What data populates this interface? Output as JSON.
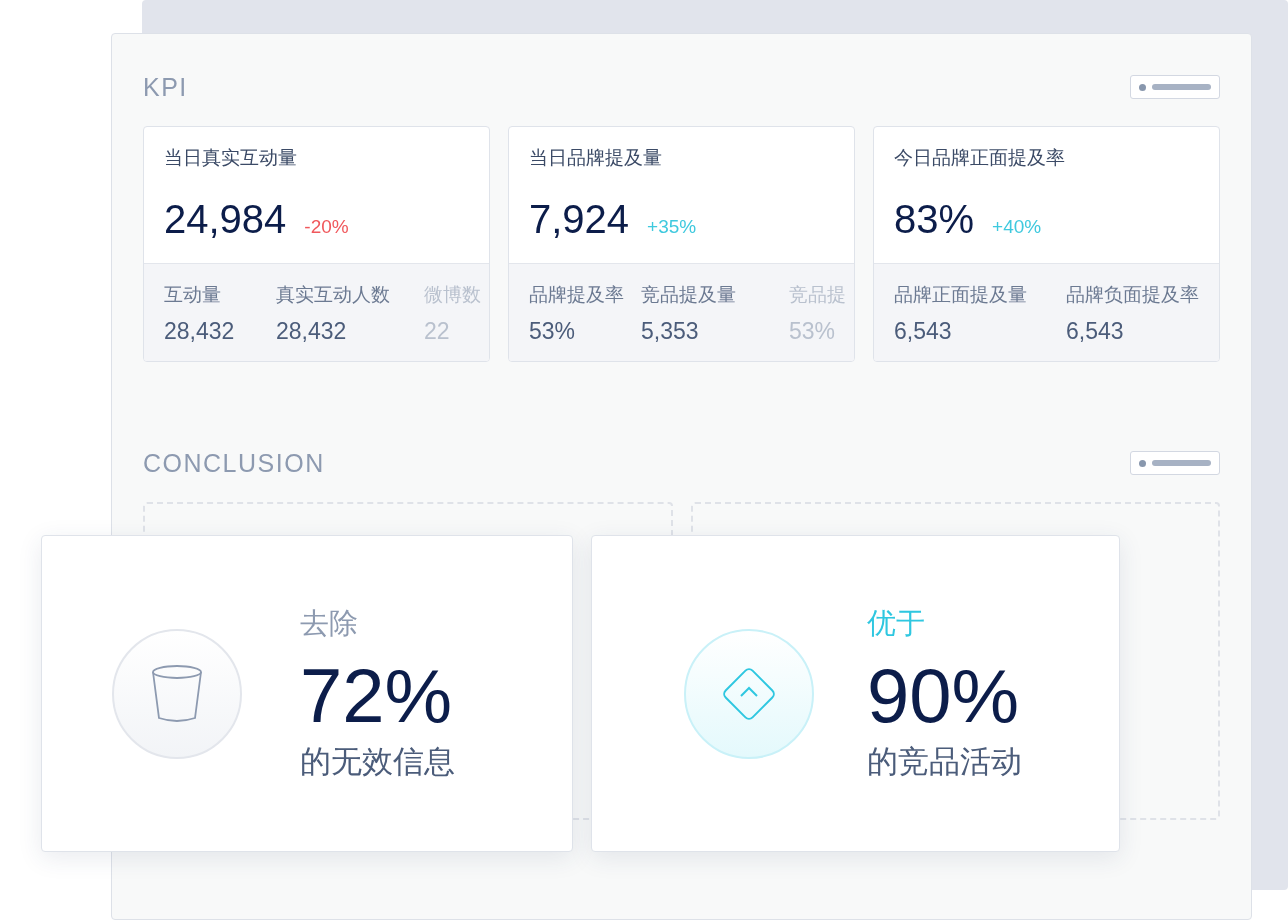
{
  "kpi": {
    "title": "KPI",
    "cards": [
      {
        "title": "当日真实互动量",
        "value": "24,984",
        "change": "-20%",
        "negative": true,
        "metrics": [
          {
            "label": "互动量",
            "value": "28,432",
            "faded": false
          },
          {
            "label": "真实互动人数",
            "value": "28,432",
            "faded": false
          },
          {
            "label": "微博数",
            "value": "22",
            "faded": true
          }
        ]
      },
      {
        "title": "当日品牌提及量",
        "value": "7,924",
        "change": "+35%",
        "negative": false,
        "metrics": [
          {
            "label": "品牌提及率",
            "value": "53%",
            "faded": false
          },
          {
            "label": "竞品提及量",
            "value": "5,353",
            "faded": false
          },
          {
            "label": "竞品提",
            "value": "53%",
            "faded": true
          }
        ]
      },
      {
        "title": "今日品牌正面提及率",
        "value": "83%",
        "change": "+40%",
        "negative": false,
        "metrics": [
          {
            "label": "品牌正面提及量",
            "value": "6,543",
            "faded": false
          },
          {
            "label": "品牌负面提及率",
            "value": "6,543",
            "faded": false
          }
        ]
      }
    ]
  },
  "conclusion": {
    "title": "CONCLUSION",
    "cards": [
      {
        "kind": "trash",
        "label": "去除",
        "value": "72%",
        "caption": "的无效信息"
      },
      {
        "kind": "diamond",
        "label": "优于",
        "value": "90%",
        "caption": "的竞品活动"
      }
    ]
  }
}
